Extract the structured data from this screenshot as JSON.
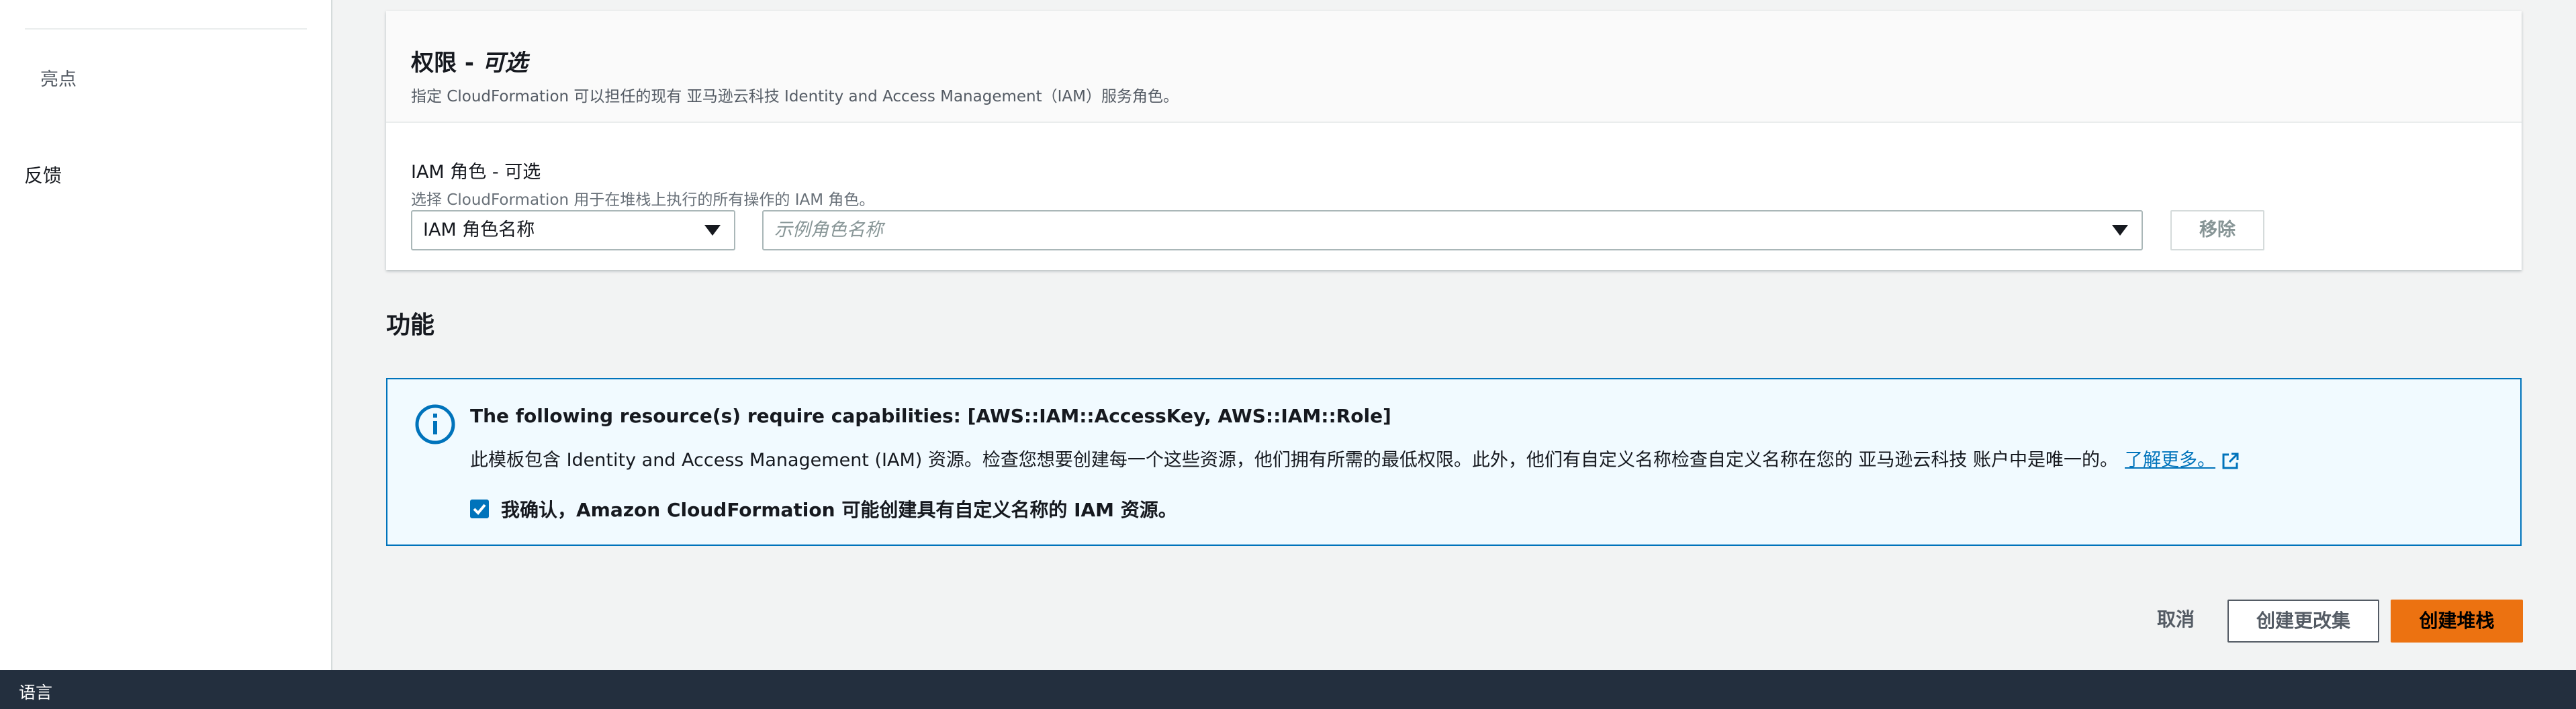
{
  "sidebar": {
    "highlights": "亮点",
    "feedback": "反馈"
  },
  "permissions": {
    "title": "权限 - ",
    "title_optional": "可选",
    "description": "指定 CloudFormation 可以担任的现有 亚马逊云科技 Identity and Access Management（IAM）服务角色。",
    "role_label": "IAM 角色 - 可选",
    "role_description": "选择 CloudFormation 用于在堆栈上执行的所有操作的 IAM 角色。",
    "role_type_selected": "IAM 角色名称",
    "role_name_placeholder": "示例角色名称",
    "remove_label": "移除"
  },
  "capabilities": {
    "section_title": "功能",
    "alert_title": "The following resource(s) require capabilities: [AWS::IAM::AccessKey, AWS::IAM::Role]",
    "alert_body": "此模板包含 Identity and Access Management (IAM) 资源。检查您想要创建每一个这些资源，他们拥有所需的最低权限。此外，他们有自定义名称检查自定义名称在您的 亚马逊云科技 账户中是唯一的。",
    "learn_more": "了解更多。",
    "acknowledge_label": "我确认，Amazon CloudFormation 可能创建具有自定义名称的 IAM 资源。",
    "acknowledge_checked": true
  },
  "actions": {
    "cancel": "取消",
    "create_change_set": "创建更改集",
    "create_stack": "创建堆栈"
  },
  "footer": {
    "language": "语言"
  },
  "icons": {
    "info": "info-circle-icon",
    "external": "external-link-icon",
    "caret": "caret-down-icon",
    "check": "check-icon"
  },
  "colors": {
    "primary": "#ec7211",
    "link": "#0073bb",
    "alert_bg": "#f1faff",
    "footer_bg": "#232f3e"
  }
}
